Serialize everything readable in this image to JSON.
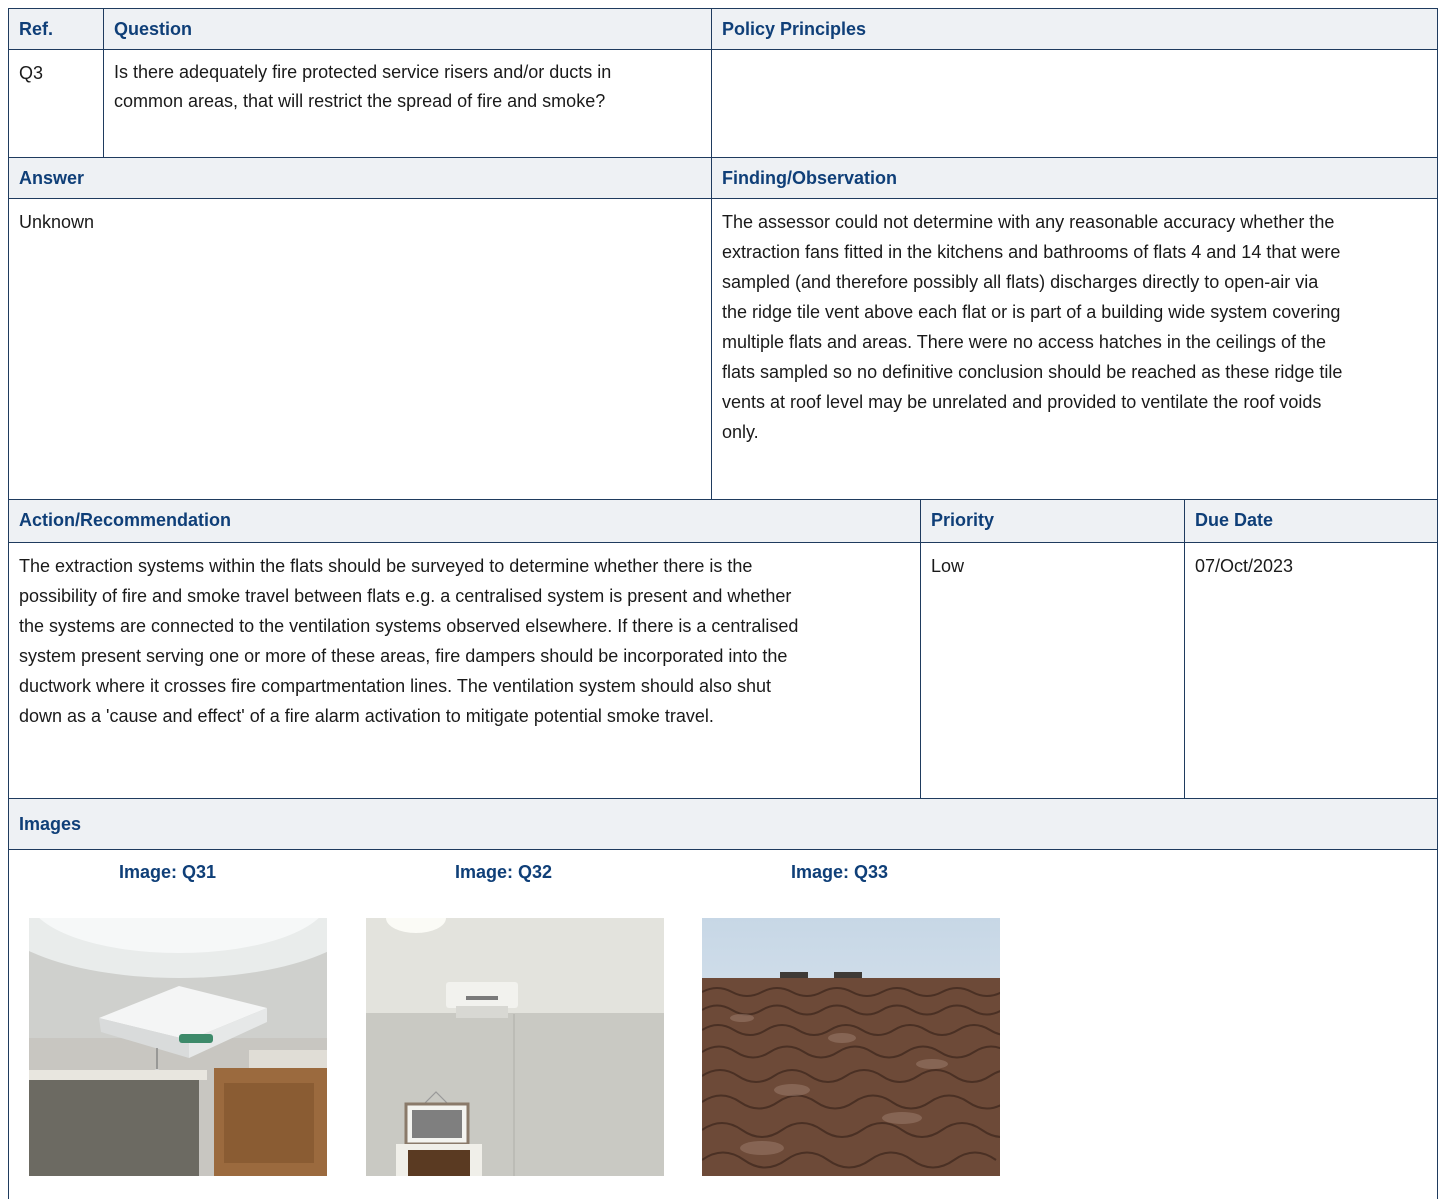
{
  "headers": {
    "ref": "Ref.",
    "question": "Question",
    "policy": "Policy Principles",
    "answer": "Answer",
    "finding": "Finding/Observation",
    "action": "Action/Recommendation",
    "priority": "Priority",
    "due_date": "Due Date",
    "images": "Images"
  },
  "item": {
    "ref": "Q3",
    "question": "Is there adequately fire protected service risers and/or ducts in common areas, that will restrict the spread of fire and smoke?",
    "policy": "",
    "answer": "Unknown",
    "finding": "The assessor could not determine with any reasonable accuracy whether the extraction fans fitted in the kitchens and bathrooms of flats 4 and 14 that were sampled (and therefore possibly all flats) discharges directly to open-air via the ridge tile vent above each flat or is part of a building wide system covering multiple flats and areas. There were no access hatches in the ceilings of the flats sampled so no definitive conclusion should be reached as these ridge tile vents at roof level may be unrelated and provided to ventilate the roof voids only.",
    "action": "The extraction systems within the flats should be surveyed to determine whether there is the possibility of fire and smoke travel between flats e.g. a centralised system is present and whether the systems are connected to the ventilation systems observed elsewhere. If there is a centralised system present serving one or more of these areas, fire dampers should be incorporated into the ductwork where it crosses fire compartmentation lines. The ventilation system should also shut down as a 'cause and effect' of a fire alarm activation to mitigate potential smoke travel.",
    "priority": "Low",
    "due_date": "07/Oct/2023"
  },
  "images": [
    {
      "caption": "Image: Q31",
      "subject": "ceiling extractor fan above window blind"
    },
    {
      "caption": "Image: Q32",
      "subject": "wall mounted extractor above doorway"
    },
    {
      "caption": "Image: Q33",
      "subject": "roof tiles with ridge vent"
    }
  ],
  "colors": {
    "header_text": "#0f3f78",
    "header_bg": "#eef1f4",
    "border": "#1f3b5e"
  }
}
